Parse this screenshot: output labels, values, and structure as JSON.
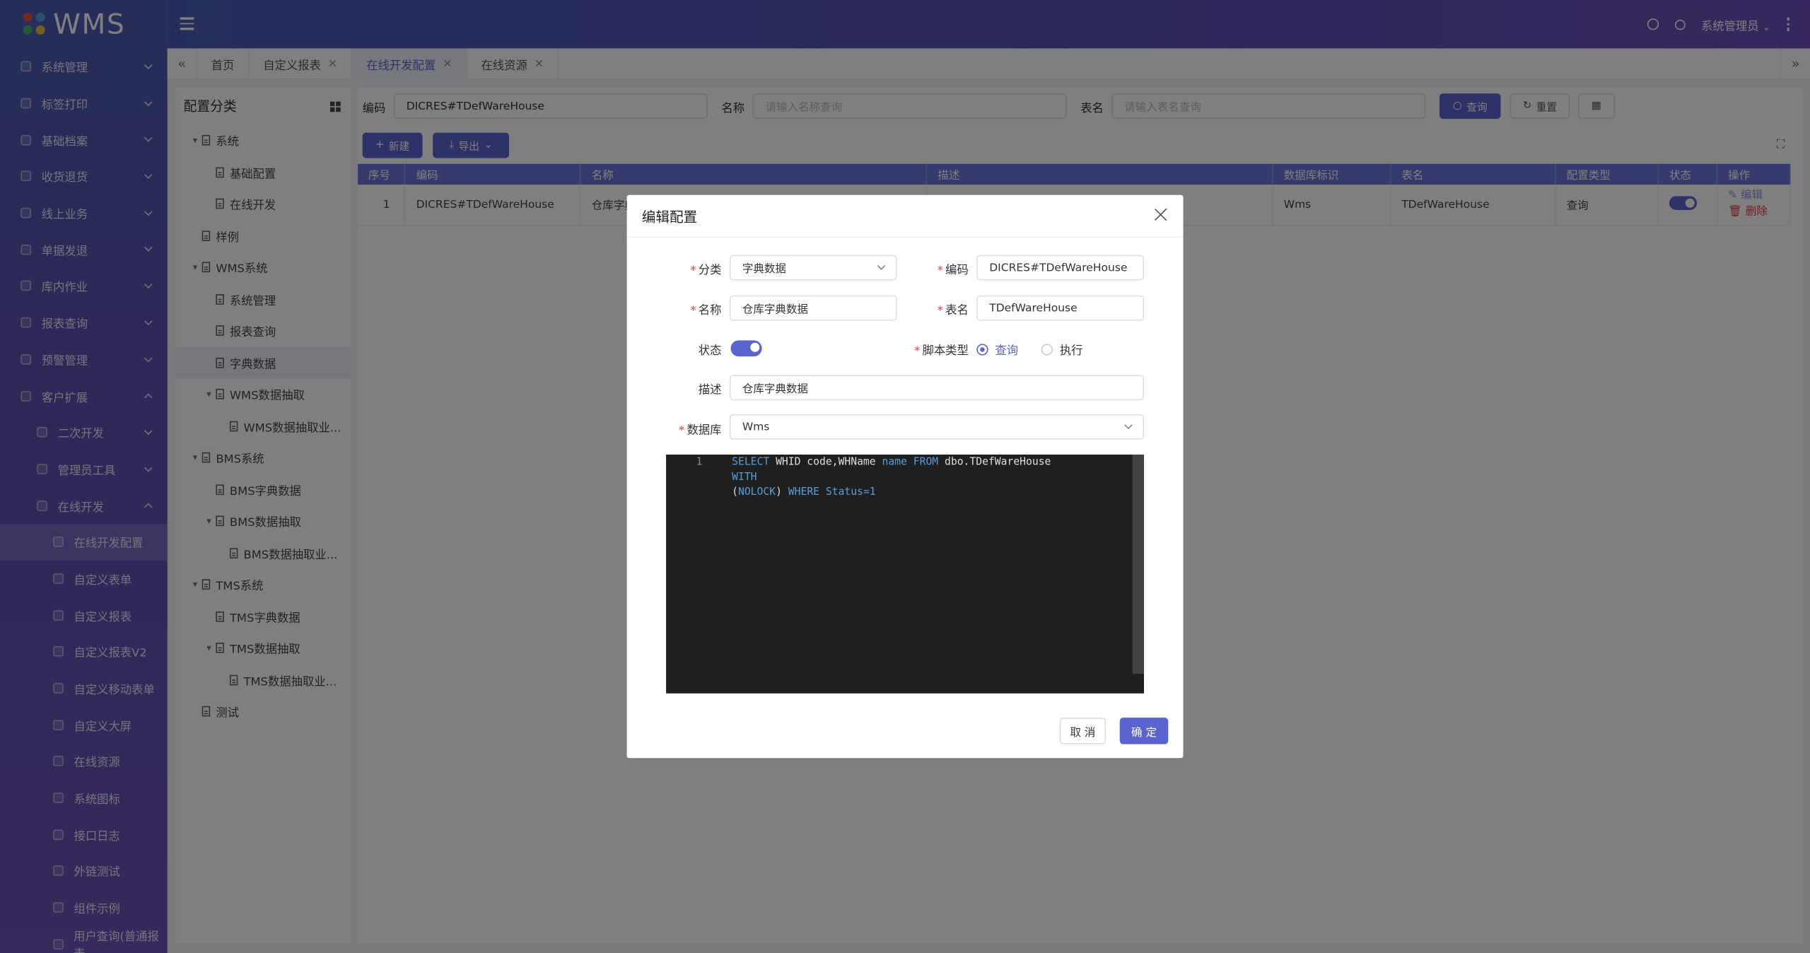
{
  "app": {
    "logo": "WMS"
  },
  "header": {
    "user": "系统管理员"
  },
  "sidebar": {
    "items": [
      {
        "label": "系统管理",
        "level": 1,
        "expanded": false
      },
      {
        "label": "标签打印",
        "level": 1,
        "expanded": false
      },
      {
        "label": "基础档案",
        "level": 1,
        "expanded": false
      },
      {
        "label": "收货退货",
        "level": 1,
        "expanded": false
      },
      {
        "label": "线上业务",
        "level": 1,
        "expanded": false
      },
      {
        "label": "单据发退",
        "level": 1,
        "expanded": false
      },
      {
        "label": "库内作业",
        "level": 1,
        "expanded": false
      },
      {
        "label": "报表查询",
        "level": 1,
        "expanded": false
      },
      {
        "label": "预警管理",
        "level": 1,
        "expanded": false
      },
      {
        "label": "客户扩展",
        "level": 1,
        "expanded": true
      },
      {
        "label": "二次开发",
        "level": 2,
        "expanded": false
      },
      {
        "label": "管理员工具",
        "level": 2,
        "expanded": false
      },
      {
        "label": "在线开发",
        "level": 2,
        "expanded": true
      },
      {
        "label": "在线开发配置",
        "level": 3,
        "active": true
      },
      {
        "label": "自定义表单",
        "level": 3
      },
      {
        "label": "自定义报表",
        "level": 3
      },
      {
        "label": "自定义报表V2",
        "level": 3
      },
      {
        "label": "自定义移动表单",
        "level": 3
      },
      {
        "label": "自定义大屏",
        "level": 3
      },
      {
        "label": "在线资源",
        "level": 3
      },
      {
        "label": "系统图标",
        "level": 3
      },
      {
        "label": "接口日志",
        "level": 3
      },
      {
        "label": "外链测试",
        "level": 3
      },
      {
        "label": "组件示例",
        "level": 3
      },
      {
        "label": "用户查询(普通报表",
        "level": 3
      }
    ]
  },
  "tabs": {
    "items": [
      {
        "label": "首页",
        "closable": false
      },
      {
        "label": "自定义报表",
        "closable": true
      },
      {
        "label": "在线开发配置",
        "closable": true,
        "active": true
      },
      {
        "label": "在线资源",
        "closable": true
      }
    ]
  },
  "left_panel": {
    "title": "配置分类",
    "tree": [
      {
        "label": "系统",
        "depth": 0,
        "arrow": "▾"
      },
      {
        "label": "基础配置",
        "depth": 1
      },
      {
        "label": "在线开发",
        "depth": 1
      },
      {
        "label": "样例",
        "depth": 0
      },
      {
        "label": "WMS系统",
        "depth": 0,
        "arrow": "▾"
      },
      {
        "label": "系统管理",
        "depth": 1
      },
      {
        "label": "报表查询",
        "depth": 1
      },
      {
        "label": "字典数据",
        "depth": 1,
        "selected": true
      },
      {
        "label": "WMS数据抽取",
        "depth": 1,
        "arrow": "▾"
      },
      {
        "label": "WMS数据抽取业...",
        "depth": 2
      },
      {
        "label": "BMS系统",
        "depth": 0,
        "arrow": "▾"
      },
      {
        "label": "BMS字典数据",
        "depth": 1
      },
      {
        "label": "BMS数据抽取",
        "depth": 1,
        "arrow": "▾"
      },
      {
        "label": "BMS数据抽取业...",
        "depth": 2
      },
      {
        "label": "TMS系统",
        "depth": 0,
        "arrow": "▾"
      },
      {
        "label": "TMS字典数据",
        "depth": 1
      },
      {
        "label": "TMS数据抽取",
        "depth": 1,
        "arrow": "▾"
      },
      {
        "label": "TMS数据抽取业...",
        "depth": 2
      },
      {
        "label": "测试",
        "depth": 0
      }
    ]
  },
  "search": {
    "code_label": "编码",
    "code_value": "DICRES#TDefWareHouse",
    "name_label": "名称",
    "name_placeholder": "请输入名称查询",
    "table_label": "表名",
    "table_placeholder": "请输入表名查询",
    "query_btn": "查询",
    "reset_btn": "重置"
  },
  "toolbar": {
    "new_btn": "新建",
    "export_btn": "导出"
  },
  "table": {
    "headers": [
      "序号",
      "编码",
      "名称",
      "描述",
      "数据库标识",
      "表名",
      "配置类型",
      "状态",
      "操作"
    ],
    "rows": [
      {
        "index": "1",
        "code": "DICRES#TDefWareHouse",
        "name": "仓库字典",
        "desc": "",
        "db": "Wms",
        "table": "TDefWareHouse",
        "type": "查询",
        "status": true,
        "edit": "编辑",
        "delete": "删除"
      }
    ]
  },
  "dialog": {
    "title": "编辑配置",
    "category_label": "分类",
    "category_value": "字典数据",
    "code_label": "编码",
    "code_value": "DICRES#TDefWareHouse",
    "name_label": "名称",
    "name_value": "仓库字典数据",
    "table_label": "表名",
    "table_value": "TDefWareHouse",
    "status_label": "状态",
    "status_on": true,
    "script_type_label": "脚本类型",
    "script_options": [
      {
        "label": "查询",
        "checked": true
      },
      {
        "label": "执行",
        "checked": false
      }
    ],
    "desc_label": "描述",
    "desc_value": "仓库字典数据",
    "db_label": "数据库",
    "db_value": "Wms",
    "editor": {
      "line": "1",
      "code_line1": "SELECT WHID code,WHName name FROM dbo.TDefWareHouse WITH",
      "code_line2": "(NOLOCK) WHERE Status=1"
    },
    "cancel_btn": "取 消",
    "ok_btn": "确 定"
  },
  "colors": {
    "primary": "#5b63d0",
    "sidebar": "#5a55b3",
    "danger": "#e4393c"
  }
}
